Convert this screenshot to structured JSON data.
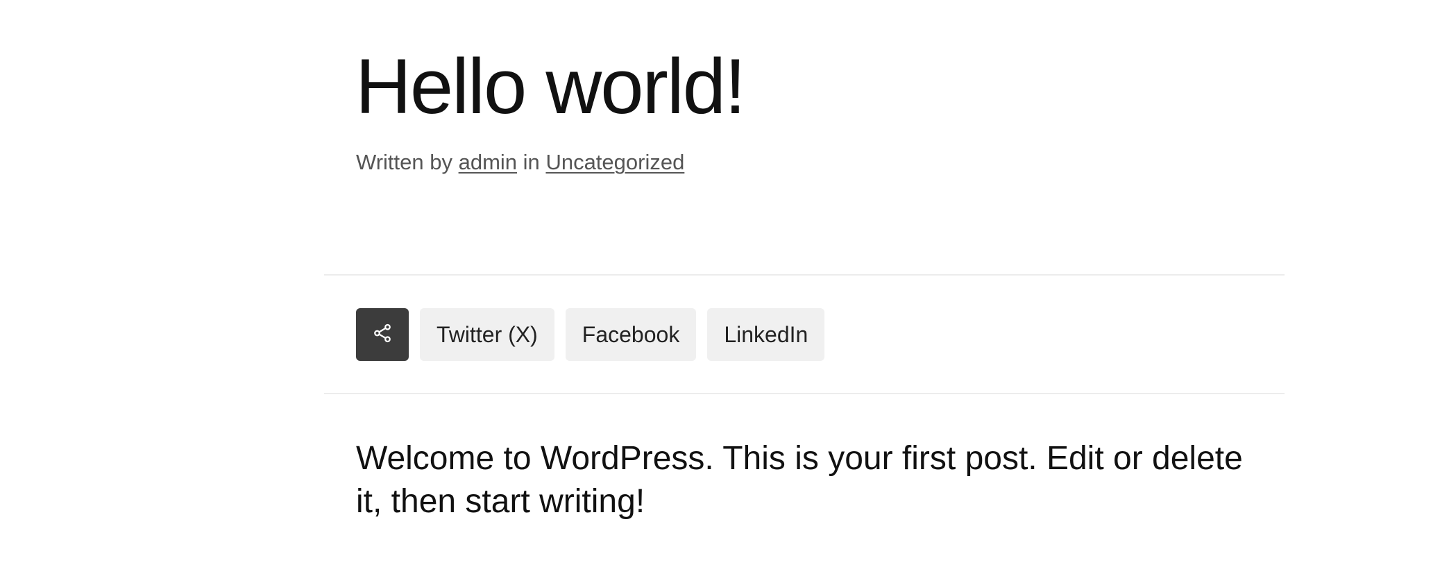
{
  "post": {
    "title": "Hello world!",
    "meta": {
      "prefix": "Written by",
      "author": "admin",
      "in_word": "in",
      "category": "Uncategorized"
    },
    "content": "Welcome to WordPress. This is your first post. Edit or delete it, then start writing!"
  },
  "share": {
    "toggle_icon": "share-icon",
    "buttons": [
      {
        "label": "Twitter (X)"
      },
      {
        "label": "Facebook"
      },
      {
        "label": "LinkedIn"
      }
    ]
  },
  "colors": {
    "share_toggle_bg": "#3c3c3c",
    "share_button_bg": "#f0f0f0",
    "meta_text": "#555555",
    "divider": "#ececec"
  }
}
